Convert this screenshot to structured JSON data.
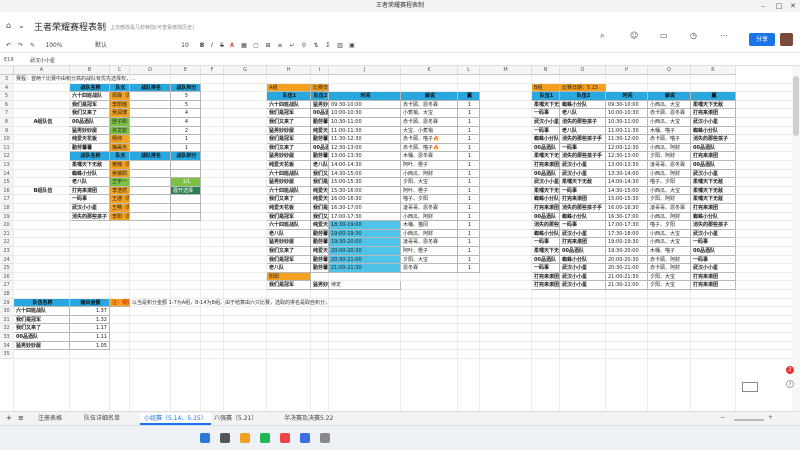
{
  "window": {
    "title": "王者荣耀赛程表制"
  },
  "header": {
    "doc_title": "王者荣耀赛程表制",
    "save_status": "上次修改是几秒钟前(可查看修改历史)",
    "share_label": "分享"
  },
  "toolbar": {
    "zoom": "100%",
    "font": "默认",
    "font_size": "10",
    "bold": "B",
    "italic": "I",
    "strike": "S",
    "color": "A"
  },
  "formula": {
    "cell_ref": "E19",
    "content": "武汉小小星"
  },
  "columns": [
    "A",
    "B",
    "C",
    "D",
    "E",
    "F",
    "G",
    "H",
    "I",
    "J",
    "K",
    "L",
    "M",
    "N",
    "O",
    "P",
    "Q",
    "R"
  ],
  "rows": [
    "3",
    "4",
    "5",
    "6",
    "7",
    "8",
    "9",
    "10",
    "11",
    "12",
    "13",
    "14",
    "15",
    "16",
    "17",
    "18",
    "19",
    "20",
    "21",
    "22",
    "23",
    "24",
    "25",
    "26",
    "27",
    "28",
    "29",
    "30",
    "31",
    "32",
    "33",
    "34",
    "35"
  ],
  "note_row": "赛程：首两个比赛中由积分高的战队有优先选择权，...",
  "groupA": {
    "label": "A组队伍",
    "header": [
      "战队名称",
      "队长",
      "战队排名",
      "战队积分"
    ],
    "rows": [
      {
        "team": "六十四班战队",
        "captain": "周霖（队长）",
        "rank": "",
        "score": "5"
      },
      {
        "team": "我们是冠军",
        "captain": "李阳瑶（队长）",
        "rank": "",
        "score": "5"
      },
      {
        "team": "我们又来了",
        "captain": "吴润博（队长）",
        "rank": "",
        "score": "4"
      },
      {
        "team": "00品酒队",
        "captain": "舒子阳（队长）",
        "rank": "",
        "score": "4"
      },
      {
        "team": "猛男妙妙屋",
        "captain": "许文钦（队长）",
        "rank": "",
        "score": "2"
      },
      {
        "team": "纯爱天花板",
        "captain": "杨帅",
        "rank": "",
        "score": "1"
      },
      {
        "team": "勤劳薯薯",
        "captain": "梅昊杰（队长）",
        "rank": "",
        "score": "1"
      }
    ]
  },
  "groupB": {
    "label": "B组队伍",
    "header": [
      "战队名称",
      "队长",
      "战队排名",
      "战队积分"
    ],
    "rows": [
      {
        "team": "柔嘿天下无敌",
        "captain": "黄楠（队长）",
        "rank": "",
        "score": ""
      },
      {
        "team": "蜘蛛小分队",
        "captain": "吴镐阳（队长）",
        "rank": "",
        "score": ""
      },
      {
        "team": "老八队",
        "captain": "王宇一（队长）",
        "rank": "",
        "score": ""
      },
      {
        "team": "打完来滚团",
        "captain": "李浩然（队长）",
        "rank": "",
        "score": ""
      },
      {
        "team": "一码事",
        "captain": "王通（队长）",
        "rank": "",
        "score": ""
      },
      {
        "team": "武汉小小星",
        "captain": "王畅（队长）",
        "rank": "",
        "score": ""
      },
      {
        "team": "消失的那些孩子",
        "captain": "李阳（队长）",
        "rank": "",
        "score": ""
      }
    ],
    "green_tag": "1/L",
    "green_tag2": "展开选择"
  },
  "scheduleA": {
    "group": "A组",
    "date": "比赛日期：5.14",
    "header": [
      "队伍1",
      "队伍2",
      "时间",
      "解说",
      "赢"
    ],
    "rows": [
      {
        "t1": "六十四班战队",
        "t2": "猛男妙妙屋",
        "time": "09:30-10:00",
        "caster": "赤卡顾、恩冬霖",
        "win": "1"
      },
      {
        "t1": "我们是冠军",
        "t2": "00品酒队",
        "time": "10:00-10:30",
        "caster": "小蕉梢、大宝",
        "win": "1"
      },
      {
        "t1": "我们又来了",
        "t2": "勤劳薯薯",
        "time": "10:30-11:00",
        "caster": "赤卡顾、恩冬霖",
        "win": "1"
      },
      {
        "t1": "猛男妙妙屋",
        "t2": "纯爱天花板",
        "time": "11:00-11:30",
        "caster": "大宝、小蕉梢",
        "win": "1"
      },
      {
        "t1": "我们是冠军",
        "t2": "勤劳薯薯",
        "time": "11:30-12:30",
        "caster": "赤卡顾、喵子🔥",
        "win": "1"
      },
      {
        "t1": "我们又来了",
        "t2": "00品酒队",
        "time": "12:30-13:00",
        "caster": "赤卡顾、喵子🔥",
        "win": "1"
      },
      {
        "t1": "猛男妙妙屋",
        "t2": "勤劳薯薯",
        "time": "13:00-13:30",
        "caster": "木桶、恩冬霖",
        "win": "1"
      },
      {
        "t1": "纯爱天花板",
        "t2": "老八队",
        "time": "14:00-14:30",
        "caster": "阿叶、橙子",
        "win": "1"
      },
      {
        "t1": "六十四班战队",
        "t2": "我们又来了",
        "time": "14:30-15:00",
        "caster": "小西瓜、阿财",
        "win": "1"
      },
      {
        "t1": "猛男妙妙屋",
        "t2": "我们是冠军",
        "time": "15:00-15:30",
        "caster": "夕阳、大宝",
        "win": "1"
      },
      {
        "t1": "六十四班战队",
        "t2": "纯爱天花板",
        "time": "15:30-16:00",
        "caster": "阿叶、橙子",
        "win": "1"
      },
      {
        "t1": "我们又来了",
        "t2": "纯爱天花板",
        "time": "16:00-16:30",
        "caster": "喵子、夕阳",
        "win": "1"
      },
      {
        "t1": "纯爱天花板",
        "t2": "我们是冠军",
        "time": "16:30-17:00",
        "caster": "凌哥哥、恩冬霖",
        "win": "1"
      },
      {
        "t1": "我们是冠军",
        "t2": "我们又来了",
        "time": "17:00-17:30",
        "caster": "小西瓜、阿财",
        "win": "1"
      },
      {
        "t1": "六十四班战队",
        "t2": "纯爱天花板",
        "time": "18:30-19:00",
        "caster": "木桶、猫冈",
        "win": "1"
      },
      {
        "t1": "老八队",
        "t2": "勤劳薯薯",
        "time": "19:00-19:30",
        "caster": "小西瓜、阿财",
        "win": "1"
      },
      {
        "t1": "猛男妙妙屋",
        "t2": "勤劳薯薯",
        "time": "19:30-20:00",
        "caster": "凌哥哥、恩冬霖",
        "win": "1"
      },
      {
        "t1": "我们又来了",
        "t2": "纯爱天花板",
        "time": "20:00-20:30",
        "caster": "阿叶、橙子",
        "win": "1"
      },
      {
        "t1": "我们是冠军",
        "t2": "勤劳薯薯",
        "time": "20:30-21:00",
        "caster": "夕阳、大宝",
        "win": "1"
      },
      {
        "t1": "老八队",
        "t2": "勤劳薯薯",
        "time": "21:00-21:30",
        "caster": "恩冬霖",
        "win": "1"
      }
    ],
    "extra_label": "阳阳",
    "extra_row": {
      "t1": "我们是冠军",
      "t2": "猛男妙妙屋",
      "time": "待定"
    }
  },
  "scheduleB": {
    "group": "B组",
    "date": "比赛日期：5.15",
    "header": [
      "队伍1",
      "队伍2",
      "时间",
      "解说",
      "赢"
    ],
    "rows": [
      {
        "t1": "柔嘿天下无敌",
        "t2": "蜘蛛小分队",
        "time": "09:30-10:00",
        "caster": "小西瓜、大宝",
        "win": "柔嘿天下无敌"
      },
      {
        "t1": "一码事",
        "t2": "老八队",
        "time": "10:00-10:30",
        "caster": "赤卡顾、恩冬霖",
        "win": "打完来滚团"
      },
      {
        "t1": "武汉小小星",
        "t2": "消失的那些孩子",
        "time": "10:30-11:00",
        "caster": "小西瓜、大宝",
        "win": "武汉小小星"
      },
      {
        "t1": "一码事",
        "t2": "老八队",
        "time": "11:00-11:30",
        "caster": "木桶、喵子",
        "win": "蜘蛛小分队"
      },
      {
        "t1": "蜘蛛小分队",
        "t2": "消失的那些孩子手",
        "time": "11:30-12:00",
        "caster": "赤卡顾、喵子",
        "win": "消失的那些孩子"
      },
      {
        "t1": "00品酒队",
        "t2": "一码事",
        "time": "12:00-12:30",
        "caster": "小西瓜、阿财",
        "win": "00品酒队"
      },
      {
        "t1": "柔嘿天下无敌",
        "t2": "消失的那些孩子手",
        "time": "12:30-13:00",
        "caster": "夕阳、阿财",
        "win": "打完来滚团"
      },
      {
        "t1": "打完来滚团",
        "t2": "武汉小小星",
        "time": "13:00-13:30",
        "caster": "凌哥哥、恩冬霖",
        "win": "00品酒队"
      },
      {
        "t1": "00品酒队",
        "t2": "武汉小小星",
        "time": "13:30-14:00",
        "caster": "小西瓜、阿财",
        "win": "武汉小小星"
      },
      {
        "t1": "武汉小小星",
        "t2": "柔嘿天下无敌",
        "time": "14:00-14:30",
        "caster": "喵子、夕阳",
        "win": "柔嘿天下无敌"
      },
      {
        "t1": "柔嘿天下无敌",
        "t2": "一码事",
        "time": "14:30-15:00",
        "caster": "小西瓜、大宝",
        "win": "柔嘿天下无敌"
      },
      {
        "t1": "蜘蛛小分队",
        "t2": "打完来滚团",
        "time": "15:00-15:30",
        "caster": "夕阳、阿财",
        "win": "柔嘿天下无敌"
      },
      {
        "t1": "打完来滚团",
        "t2": "消失的那些孩子手",
        "time": "16:00-16:30",
        "caster": "凌哥哥、恩冬霖",
        "win": "打完来滚团"
      },
      {
        "t1": "00品酒队",
        "t2": "蜘蛛小分队",
        "time": "16:30-17:00",
        "caster": "小西瓜、阿财",
        "win": "蜘蛛小分队"
      },
      {
        "t1": "消失的那些孩子手",
        "t2": "一码事",
        "time": "17:00-17:30",
        "caster": "喵子、夕阳",
        "win": "消失的那些孩子"
      },
      {
        "t1": "蜘蛛小分队",
        "t2": "武汉小小星",
        "time": "17:30-18:00",
        "caster": "小西瓜、大宝",
        "win": "武汉小小星"
      },
      {
        "t1": "一码事",
        "t2": "打完来滚团",
        "time": "19:00-19:30",
        "caster": "小西瓜、大宝",
        "win": "一码事"
      },
      {
        "t1": "柔嘿天下无敌",
        "t2": "00品酒队",
        "time": "19:30-20:00",
        "caster": "木桶、喵子",
        "win": "00品酒队"
      },
      {
        "t1": "00品酒队",
        "t2": "蜘蛛小分队",
        "time": "20:00-20:30",
        "caster": "赤卡顾、阿财",
        "win": "一码事"
      },
      {
        "t1": "一码事",
        "t2": "武汉小小星",
        "time": "20:30-21:00",
        "caster": "赤卡顾、阿财",
        "win": "武汉小小星"
      },
      {
        "t1": "打完来滚团",
        "t2": "武汉小小星",
        "time": "21:00-21:30",
        "caster": "夕阳、大宝",
        "win": "打完来滚团"
      },
      {
        "t1": "打完来滚团",
        "t2": "武汉小小星",
        "time": "21:30-22:00",
        "caster": "夕阳、大宝",
        "win": "打完来滚团"
      }
    ]
  },
  "coins": {
    "header": [
      "队伍名称",
      "输出金额"
    ],
    "rows": [
      {
        "team": "六十四班战队",
        "amount": "1.37"
      },
      {
        "team": "我们是冠军",
        "amount": "1.32"
      },
      {
        "team": "我们又来了",
        "amount": "1.17"
      },
      {
        "team": "00品酒队",
        "amount": "1.11"
      },
      {
        "team": "猛男妙妙屋",
        "amount": "1.05"
      }
    ],
    "note_label": "注：规则(以下规则)",
    "note_text": "以当是积分金额 1-7为A组，8-14为B组。由于结算由六只比赛，选取的排名是取自积分，受理解"
  },
  "tabs": [
    "注册表格",
    "队伍详细名单",
    "小组赛（5.14、5.15）",
    "八强赛（5.21）",
    "半决赛及决赛5.22"
  ],
  "active_tab": 2,
  "badges": {
    "notif": "2"
  }
}
